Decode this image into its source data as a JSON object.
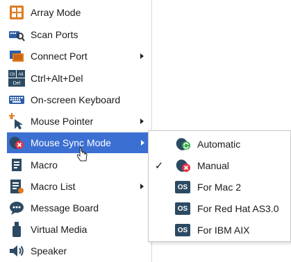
{
  "menu": {
    "items": [
      {
        "label": "Array Mode",
        "icon": "array-mode-icon",
        "submenu": false
      },
      {
        "label": "Scan Ports",
        "icon": "scan-ports-icon",
        "submenu": false
      },
      {
        "label": "Connect Port",
        "icon": "connect-port-icon",
        "submenu": true
      },
      {
        "label": "Ctrl+Alt+Del",
        "icon": "ctrl-alt-del-icon",
        "submenu": false
      },
      {
        "label": "On-screen Keyboard",
        "icon": "keyboard-icon",
        "submenu": false
      },
      {
        "label": "Mouse Pointer",
        "icon": "mouse-pointer-icon",
        "submenu": true
      },
      {
        "label": "Mouse Sync Mode",
        "icon": "mouse-sync-icon",
        "submenu": true,
        "highlighted": true
      },
      {
        "label": "Macro",
        "icon": "macro-icon",
        "submenu": false
      },
      {
        "label": "Macro List",
        "icon": "macro-list-icon",
        "submenu": true
      },
      {
        "label": "Message Board",
        "icon": "message-board-icon",
        "submenu": false
      },
      {
        "label": "Virtual Media",
        "icon": "virtual-media-icon",
        "submenu": false
      },
      {
        "label": "Speaker",
        "icon": "speaker-icon",
        "submenu": false
      }
    ],
    "ctrl_icon_text": {
      "ctrl": "Ctl",
      "alt": "Alt",
      "del": "Del"
    }
  },
  "submenu": {
    "items": [
      {
        "label": "Automatic",
        "icon": "automatic-sync-icon",
        "checked": false
      },
      {
        "label": "Manual",
        "icon": "manual-sync-icon",
        "checked": true
      },
      {
        "label": "For Mac 2",
        "icon": "os-icon",
        "checked": false
      },
      {
        "label": "For Red Hat AS3.0",
        "icon": "os-icon",
        "checked": false
      },
      {
        "label": "For IBM AIX",
        "icon": "os-icon",
        "checked": false
      }
    ],
    "check_mark": "✓",
    "os_badge": "OS"
  },
  "colors": {
    "highlight": "#3c6fd2",
    "os_badge": "#2c4a63",
    "accent_orange": "#e07a1f",
    "accent_red": "#e0354a"
  }
}
